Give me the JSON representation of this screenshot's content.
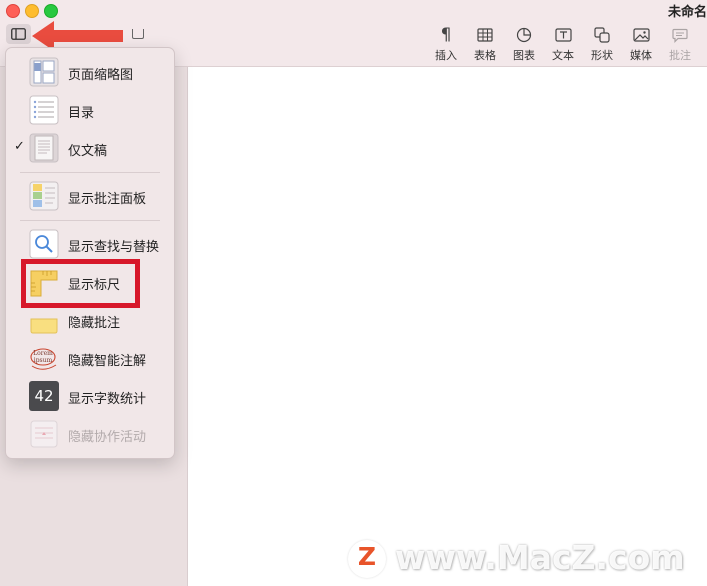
{
  "window": {
    "title": "未命名"
  },
  "toolbar": {
    "items": [
      {
        "label": "插入",
        "icon": "paragraph-icon"
      },
      {
        "label": "表格",
        "icon": "table-icon"
      },
      {
        "label": "图表",
        "icon": "chart-icon"
      },
      {
        "label": "文本",
        "icon": "textbox-icon"
      },
      {
        "label": "形状",
        "icon": "shape-icon"
      },
      {
        "label": "媒体",
        "icon": "media-icon"
      },
      {
        "label": "批注",
        "icon": "comment-icon",
        "disabled": true
      }
    ]
  },
  "view_menu": {
    "items": [
      {
        "label": "页面缩略图",
        "icon": "page-thumbnails-icon",
        "checked": false
      },
      {
        "label": "目录",
        "icon": "toc-icon",
        "checked": false
      },
      {
        "label": "仅文稿",
        "icon": "document-only-icon",
        "checked": true
      },
      {
        "label": "显示批注面板",
        "icon": "comments-pane-icon",
        "checked": false
      },
      {
        "label": "显示查找与替换",
        "icon": "find-replace-icon",
        "checked": false
      },
      {
        "label": "显示标尺",
        "icon": "ruler-icon",
        "checked": false
      },
      {
        "label": "隐藏批注",
        "icon": "comment-note-icon",
        "checked": false
      },
      {
        "label": "隐藏智能注解",
        "icon": "smart-annotation-icon",
        "checked": false,
        "icon_text": "Lorem ipsum"
      },
      {
        "label": "显示字数统计",
        "icon": "word-count-icon",
        "checked": false,
        "icon_text": "42"
      },
      {
        "label": "隐藏协作活动",
        "icon": "collaboration-activity-icon",
        "checked": false,
        "disabled": true
      }
    ],
    "check_mark": "✓"
  },
  "annotation": {
    "highlighted_item": "显示标尺",
    "color": "#d7182a"
  },
  "watermark": {
    "logo_letter": "Z",
    "text": "www.MacZ.com"
  }
}
